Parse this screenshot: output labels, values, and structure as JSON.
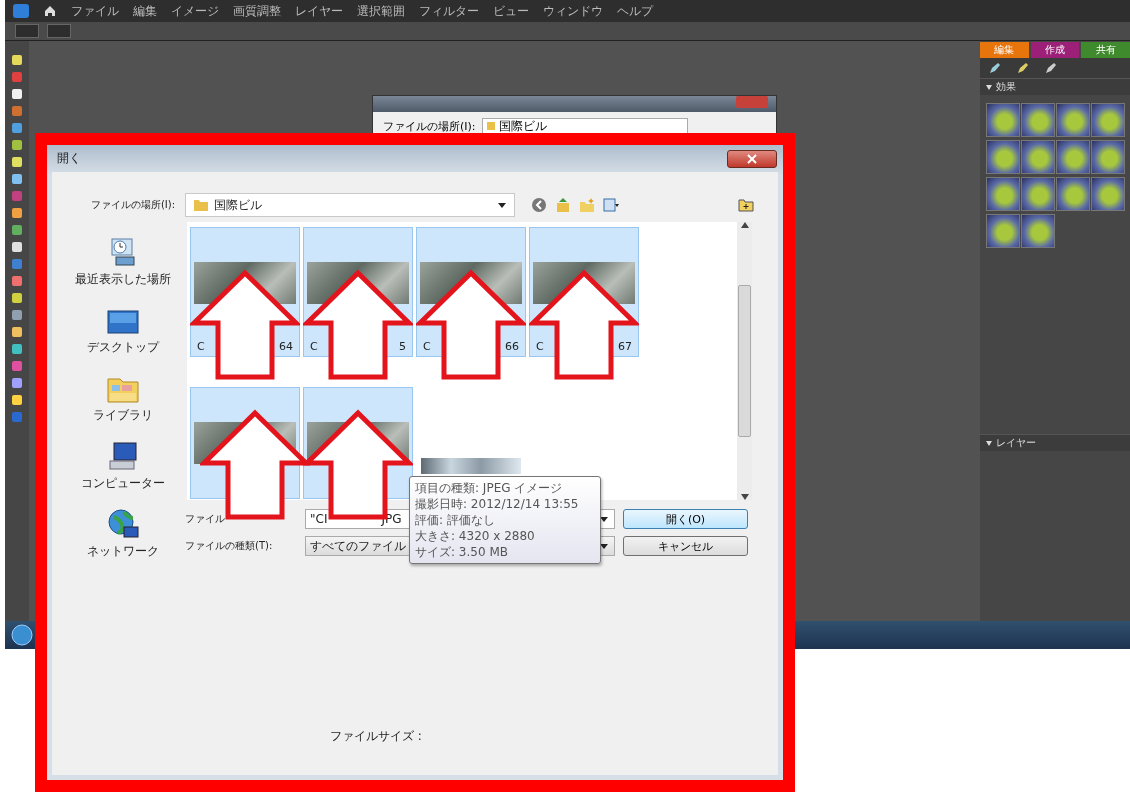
{
  "app": {
    "menu": [
      "ファイル",
      "編集",
      "イメージ",
      "画質調整",
      "レイヤー",
      "選択範囲",
      "フィルター",
      "ビュー",
      "ウィンドウ",
      "ヘルプ"
    ],
    "mode_tabs": [
      {
        "label": "編集",
        "color": "#e8740c"
      },
      {
        "label": "作成",
        "color": "#9c1f78"
      },
      {
        "label": "共有",
        "color": "#3f8a2c"
      }
    ],
    "effects_panel": {
      "title": "効果"
    },
    "layers_panel": {
      "title": "レイヤー"
    }
  },
  "back_dialog": {
    "location_label": "ファイルの場所(I):",
    "location": "国際ビル"
  },
  "dialog": {
    "title": "開く",
    "location_label": "ファイルの場所(I):",
    "location": "国際ビル",
    "places": [
      {
        "label": "最近表示した場所",
        "kind": "recent"
      },
      {
        "label": "デスクトップ",
        "kind": "desktop"
      },
      {
        "label": "ライブラリ",
        "kind": "library"
      },
      {
        "label": "コンピューター",
        "kind": "computer"
      },
      {
        "label": "ネットワーク",
        "kind": "network"
      }
    ],
    "files": [
      {
        "label_start": "C",
        "label_end": "64",
        "selected": true,
        "marked": true
      },
      {
        "label_start": "C",
        "label_end": "5",
        "selected": true,
        "marked": true
      },
      {
        "label_start": "C",
        "label_end": "66",
        "selected": true,
        "marked": true
      },
      {
        "label_start": "C",
        "label_end": "67",
        "selected": true,
        "marked": true
      },
      {
        "selected": true,
        "marked": true
      },
      {
        "selected": true,
        "marked": true
      },
      {
        "selected": false,
        "marked": false
      }
    ],
    "file_name_label": "ファイル",
    "file_name_parts": [
      "\"CI",
      "JPG"
    ],
    "file_type_label": "ファイルの種類(T):",
    "file_type": "すべてのファイル",
    "buttons": [
      {
        "label": "開く(O)",
        "default": true
      },
      {
        "label": "キャンセル",
        "default": false
      }
    ],
    "tooltip": [
      "項目の種類: JPEG イメージ",
      "撮影日時: 2012/12/14 13:55",
      "評価: 評価なし",
      "大きさ: 4320 x 2880",
      "サイズ: 3.50 MB"
    ],
    "file_size_label": "ファイルサイズ :"
  }
}
